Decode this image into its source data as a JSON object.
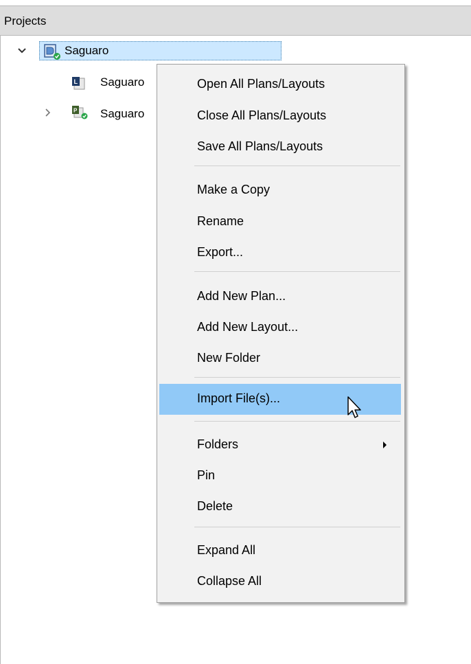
{
  "panel": {
    "title": "Projects"
  },
  "tree": {
    "root": {
      "label": "Saguaro",
      "expanded": true
    },
    "children": [
      {
        "label": "Saguaro",
        "icon": "layout-file-icon"
      },
      {
        "label": "Saguaro",
        "icon": "plan-file-icon"
      }
    ]
  },
  "context_menu": {
    "items": [
      {
        "label": "Open All Plans/Layouts"
      },
      {
        "label": "Close All Plans/Layouts"
      },
      {
        "label": "Save All Plans/Layouts"
      },
      {
        "label": "Make a Copy"
      },
      {
        "label": "Rename"
      },
      {
        "label": "Export..."
      },
      {
        "label": "Add New Plan..."
      },
      {
        "label": "Add New Layout..."
      },
      {
        "label": "New Folder"
      },
      {
        "label": "Import File(s)...",
        "highlighted": true
      },
      {
        "label": "Folders",
        "has_submenu": true
      },
      {
        "label": "Pin"
      },
      {
        "label": "Delete"
      },
      {
        "label": "Expand All"
      },
      {
        "label": "Collapse All"
      }
    ]
  },
  "colors": {
    "selection": "#cce8ff",
    "menu_highlight": "#91c9f7",
    "menu_bg": "#f2f2f2",
    "status_check": "#2aa54a"
  }
}
